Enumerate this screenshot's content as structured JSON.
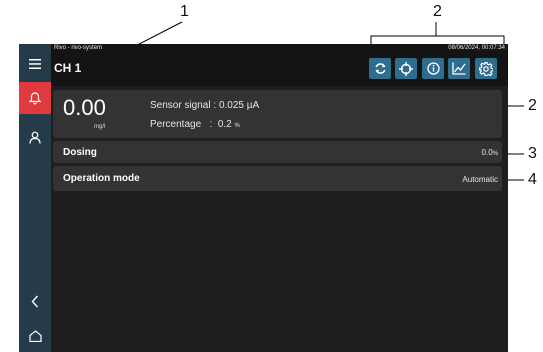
{
  "callouts": [
    "1",
    "2",
    "2",
    "3",
    "4"
  ],
  "header": {
    "subtitle": "Rivo - rivo-system",
    "datetime": "08/06/2024, 00:07:34",
    "title": "CH 1",
    "tools": [
      {
        "icon": "refresh-icon"
      },
      {
        "icon": "crosshair-icon"
      },
      {
        "icon": "info-icon"
      },
      {
        "icon": "chart-icon"
      },
      {
        "icon": "gear-icon"
      }
    ]
  },
  "sidebar": {
    "icons": [
      "menu-icon",
      "bell-icon",
      "user-icon",
      "back-icon",
      "home-icon"
    ],
    "active_color": "#e03a3e",
    "background": "#263b49"
  },
  "measurement": {
    "value": "0.00",
    "unit": "mg/l",
    "sensor_signal_label": "Sensor signal : ",
    "sensor_signal_value": "0.025 µA",
    "percentage_label": "Percentage   :  ",
    "percentage_value": "0.2",
    "percentage_unit": "%"
  },
  "rows": [
    {
      "label": "Dosing",
      "value": "0.0",
      "unit": "%"
    },
    {
      "label": "Operation mode",
      "value": "Automatic"
    }
  ],
  "accent_color": "#2f6d8e"
}
